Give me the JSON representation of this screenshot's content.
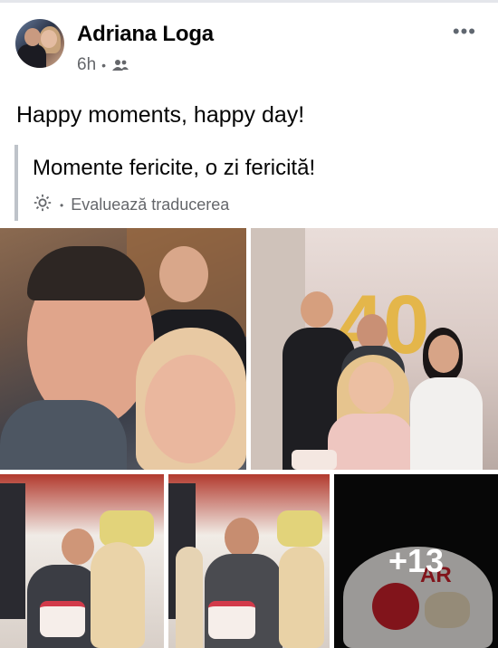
{
  "post": {
    "author": "Adriana Loga",
    "time": "6h",
    "audience_icon": "friends-icon",
    "more_label": "•••",
    "text": "Happy moments, happy day!"
  },
  "translation": {
    "text": "Momente fericite, o zi fericită!",
    "settings_icon": "gear-icon",
    "rate_label": "Evaluează traducerea"
  },
  "photos": {
    "extra_count": "+13",
    "cake_text": "AR",
    "balloon_number": "40"
  },
  "colors": {
    "secondary_text": "#65676b",
    "divider": "#bec3c9"
  }
}
